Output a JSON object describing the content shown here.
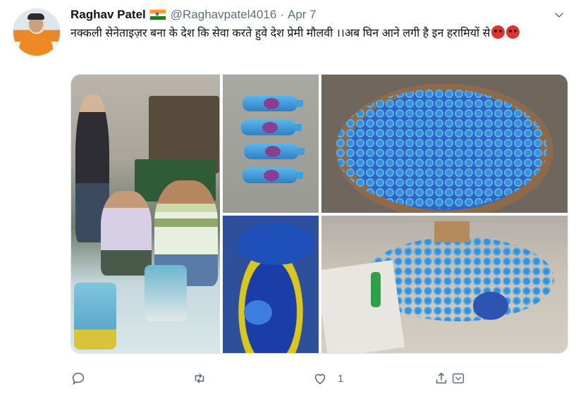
{
  "tweet": {
    "author_name": "Raghav Patel",
    "handle": "@Raghavpatel4016",
    "separator": "·",
    "date": "Apr 7",
    "text": "नक्कली सेनेताइज़र बना के देश कि  सेवा करते हुवे देश प्रेमी मौलवी  ।।अब घिन आने लगी है इन हरामियों से",
    "emojis": [
      "angry-face-icon",
      "angry-face-icon"
    ],
    "media_count": 5,
    "actions": {
      "reply_icon": "reply-icon",
      "retweet_icon": "retweet-icon",
      "like_icon": "heart-icon",
      "like_count": "1",
      "share_icon": "share-icon",
      "more_icon": "chevron-down-icon"
    }
  },
  "colors": {
    "text": "#0f1419",
    "muted": "#5b7083"
  }
}
